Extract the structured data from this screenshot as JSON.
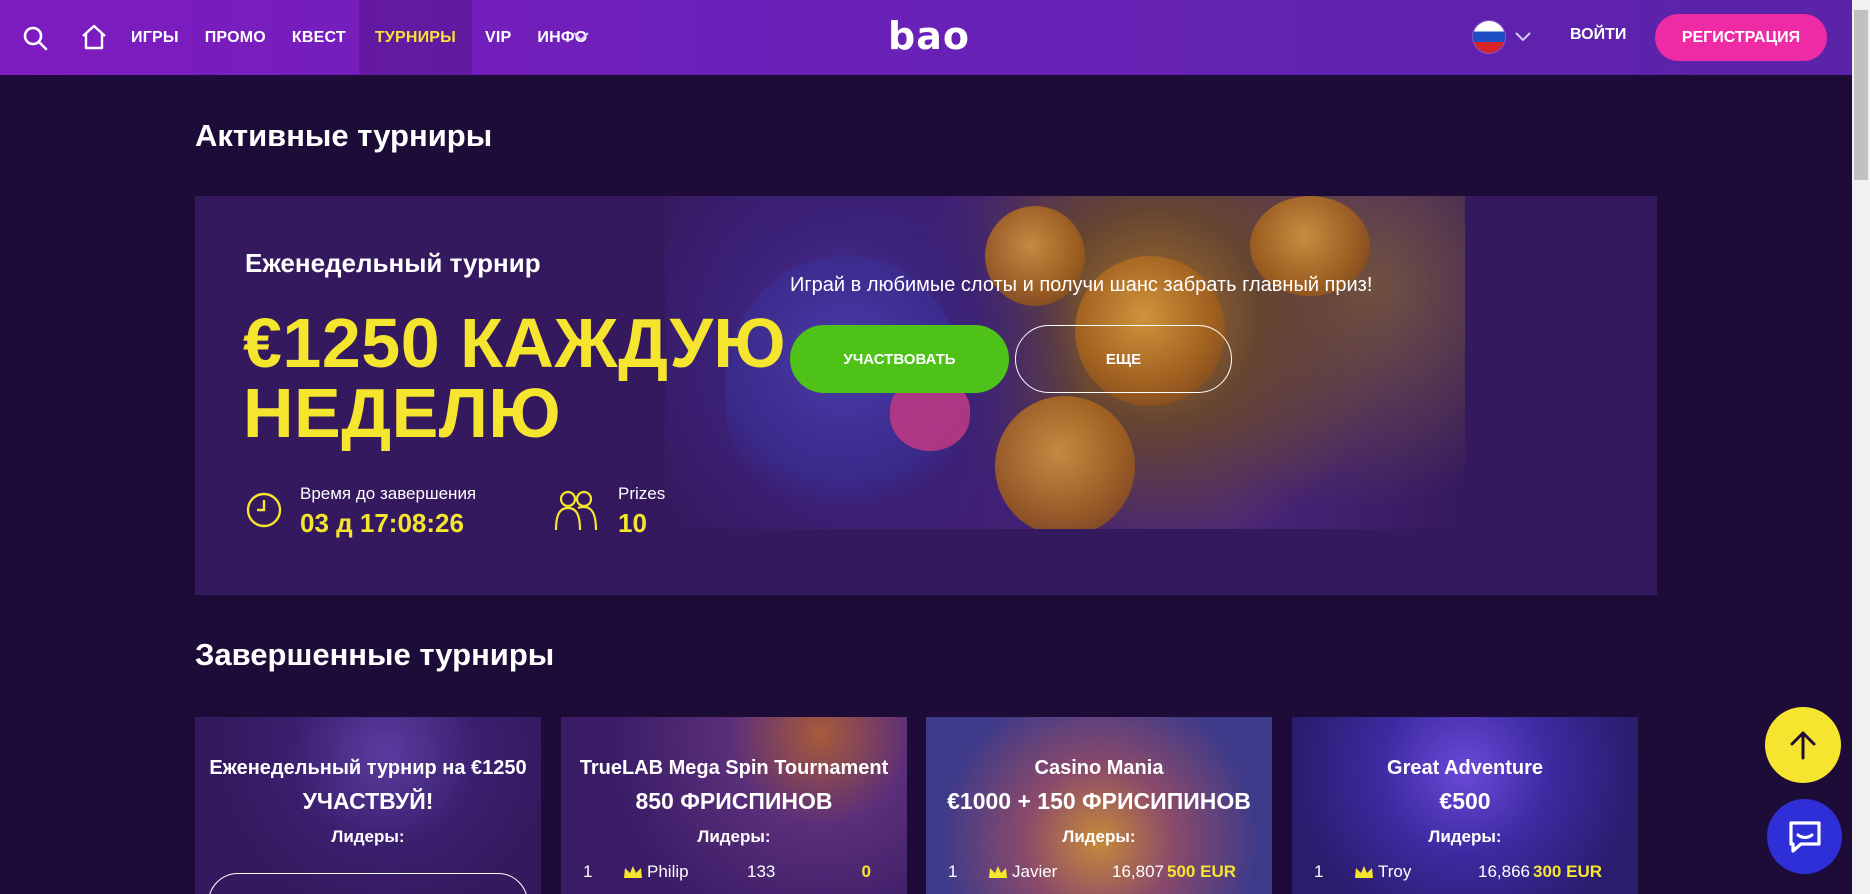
{
  "header": {
    "nav": [
      "ИГРЫ",
      "ПРОМО",
      "КВЕСТ",
      "ТУРНИРЫ",
      "VIP",
      "ИНФО"
    ],
    "active_nav": "ТУРНИРЫ",
    "logo": "bao",
    "login": "ВОЙТИ",
    "register": "РЕГИСТРАЦИЯ",
    "icons": [
      "search-icon",
      "home-icon",
      "chevron-down-icon",
      "russia-flag-icon"
    ]
  },
  "active_section": {
    "title": "Активные турниры",
    "tournament": {
      "subtitle": "Еженедельный турнир",
      "prize_line1": "€1250 КАЖДУЮ",
      "prize_line2": "НЕДЕЛЮ",
      "description": "Играй в любимые слоты и получи шанс забрать главный приз!",
      "join_label": "УЧАСТВОВАТЬ",
      "more_label": "ЕЩЕ",
      "timer_label": "Время до завершения",
      "timer_value": "03 д 17:08:26",
      "prizes_label": "Prizes",
      "prizes_value": "10"
    }
  },
  "finished_section": {
    "title": "Завершенные турниры",
    "cards": [
      {
        "title": "Еженедельный турнир на €1250",
        "prize": "УЧАСТВУЙ!",
        "leaders_label": "Лидеры:"
      },
      {
        "title": "TrueLAB Mega Spin Tournament",
        "prize": "850 ФРИСПИНОВ",
        "leaders_label": "Лидеры:",
        "row": {
          "rank": "1",
          "name": "Philip",
          "score": "133",
          "prize": "0"
        }
      },
      {
        "title": "Casino Mania",
        "prize": "€1000 + 150 ФРИСИПИНОВ",
        "leaders_label": "Лидеры:",
        "row": {
          "rank": "1",
          "name": "Javier",
          "score": "16,807",
          "prize": "500 EUR"
        }
      },
      {
        "title": "Great Adventure",
        "prize": "€500",
        "leaders_label": "Лидеры:",
        "row": {
          "rank": "1",
          "name": "Troy",
          "score": "16,866",
          "prize": "300 EUR"
        }
      }
    ]
  },
  "colors": {
    "background": "#1c0c37",
    "header": "#6a21b8",
    "accent_yellow": "#f6e52f",
    "register_pink": "#ee2aa4",
    "join_green": "#4ec218",
    "chat_blue": "#2f2fd8"
  }
}
